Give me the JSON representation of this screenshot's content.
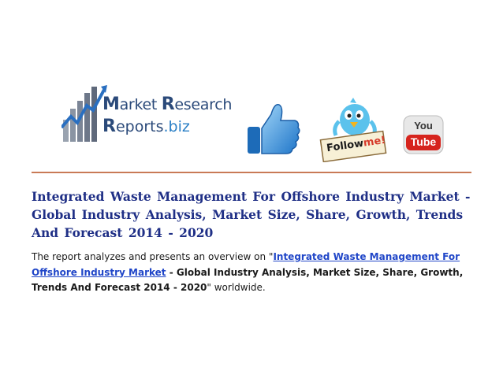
{
  "logo": {
    "line1_cap1": "M",
    "line1_rest1": "arket ",
    "line1_cap2": "R",
    "line1_rest2": "esearch",
    "line2_cap": "R",
    "line2_rest": "eports",
    "line2_biz": ".biz",
    "colors": {
      "primary": "#2b4a7a",
      "accent": "#2a7fc6"
    }
  },
  "social": {
    "like_icon": "thumbs-up-icon",
    "follow_label_1": "Follow",
    "follow_label_2": "me!",
    "youtube_label_1": "You",
    "youtube_label_2": "Tube"
  },
  "title": "Integrated Waste Management For Offshore Industry Market - Global Industry Analysis, Market Size, Share, Growth, Trends And Forecast 2014 - 2020",
  "body": {
    "intro": "The report analyzes and presents an overview on \"",
    "link_text": "Integrated Waste Management For Offshore Industry Market",
    "bold_text": " - Global Industry Analysis, Market Size, Share, Growth, Trends And Forecast 2014 - 2020",
    "outro": "\" worldwide."
  },
  "colors": {
    "title": "#1f2f86",
    "link": "#2046c8",
    "divider": "#c97a56"
  }
}
